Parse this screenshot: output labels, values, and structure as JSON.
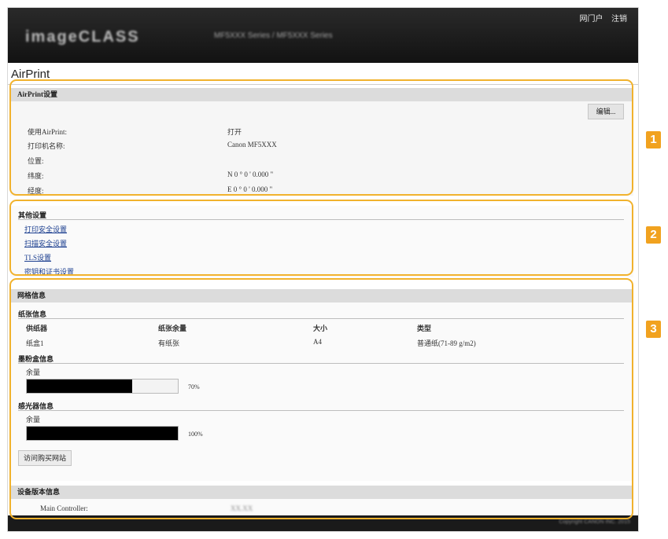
{
  "header": {
    "logo_text": "imageCLASS",
    "model_text": "MF5XXX Series / MF5XXX Series",
    "logout_label": "网门户",
    "login_label": "注销"
  },
  "page_title": "AirPrint",
  "airprint_settings": {
    "heading": "AirPrint设置",
    "edit_label": "编辑...",
    "rows": [
      {
        "label": "使用AirPrint:",
        "value": "打开"
      },
      {
        "label": "打印机名称:",
        "value": "Canon MF5XXX"
      },
      {
        "label": "位置:",
        "value": ""
      },
      {
        "label": "纬度:",
        "value": "N 0 °  0 '  0.000 \""
      },
      {
        "label": "经度:",
        "value": "E 0 °  0 '  0.000 \""
      }
    ]
  },
  "other_settings": {
    "heading": "其他设置",
    "links": [
      "打印安全设置",
      "扫描安全设置",
      "TLS设置",
      "密钥和证书设置"
    ]
  },
  "network_info": {
    "heading": "网格信息",
    "paper_info": {
      "heading": "纸张信息",
      "columns": [
        "供纸器",
        "纸张余量",
        "大小",
        "类型"
      ],
      "rows": [
        [
          "纸盒1",
          "有纸张",
          "A4",
          "普通纸(71-89 g/m2)"
        ]
      ]
    },
    "toner_info": {
      "heading": "墨粉盒信息",
      "remaining_label": "余量",
      "level": 70,
      "percent_text": "70%"
    },
    "drum_info": {
      "heading": "感光器信息",
      "remaining_label": "余量",
      "level": 100,
      "percent_text": "100%"
    },
    "purchase_button": "访问购买网站"
  },
  "device_version": {
    "heading": "设备版本信息",
    "rows": [
      {
        "label": "Main Controller:",
        "value": "XX.XX"
      }
    ]
  },
  "callouts": [
    "1",
    "2",
    "3"
  ],
  "footer": {
    "copyright": "Copyright CANON INC. 2015"
  },
  "colors": {
    "callout": "#f1b22d",
    "badge": "#f1a21f",
    "link": "#1a3d8f",
    "header_bg": "#1e1e1e"
  }
}
